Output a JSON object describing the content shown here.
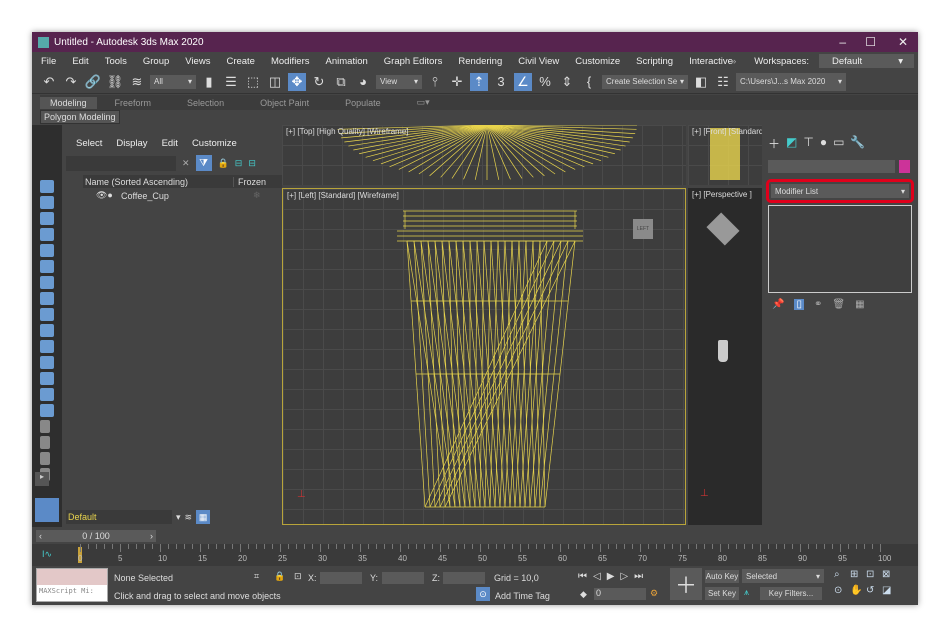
{
  "window": {
    "title": "Untitled - Autodesk 3ds Max 2020",
    "min": "–",
    "max": "☐",
    "close": "✕"
  },
  "menu": [
    "File",
    "Edit",
    "Tools",
    "Group",
    "Views",
    "Create",
    "Modifiers",
    "Animation",
    "Graph Editors",
    "Rendering",
    "Civil View",
    "Customize",
    "Scripting",
    "Interactive"
  ],
  "workspaces": {
    "label": "Workspaces:",
    "value": "Default"
  },
  "toolbar": {
    "filter": "All",
    "ref_coord": "View",
    "selection_set": "Create Selection Se",
    "path": "C:\\Users\\J...s Max 2020"
  },
  "ribbon": {
    "tabs": [
      "Modeling",
      "Freeform",
      "Selection",
      "Object Paint",
      "Populate"
    ],
    "active": "Modeling",
    "panel": "Polygon Modeling"
  },
  "scene_explorer": {
    "menu": [
      "Select",
      "Display",
      "Edit",
      "Customize"
    ],
    "search_placeholder": "",
    "col_name": "Name (Sorted Ascending)",
    "col_frozen": "Frozen",
    "items": [
      {
        "name": "Coffee_Cup"
      }
    ],
    "layer": "Default"
  },
  "viewports": {
    "top": "[+] [Top] [High Quality] [Wireframe]",
    "front": "[+] [Front] [Standard]",
    "left": "[+] [Left] [Standard] [Wireframe]",
    "perspective": "[+] [Perspective ]",
    "wire_color": "#e8d44d",
    "viewcube_label": "LEFT"
  },
  "command_panel": {
    "modifier_list": "Modifier List",
    "highlight_color": "#e0001b",
    "object_color": "#cc3399"
  },
  "timeline": {
    "frame": "0 / 100",
    "ticks": [
      "0",
      "5",
      "10",
      "15",
      "20",
      "25",
      "30",
      "35",
      "40",
      "45",
      "50",
      "55",
      "60",
      "65",
      "70",
      "75",
      "80",
      "85",
      "90",
      "95",
      "100"
    ]
  },
  "status": {
    "maxscript": "MAXScript Mi:",
    "selection": "None Selected",
    "prompt": "Click and drag to select and move objects",
    "x": "X:",
    "y": "Y:",
    "z": "Z:",
    "grid": "Grid = 10,0",
    "add_time_tag": "Add Time Tag",
    "auto_key": "Auto Key",
    "set_key": "Set Key",
    "key_mode": "Selected",
    "key_filters": "Key Filters...",
    "current_frame": "0"
  }
}
